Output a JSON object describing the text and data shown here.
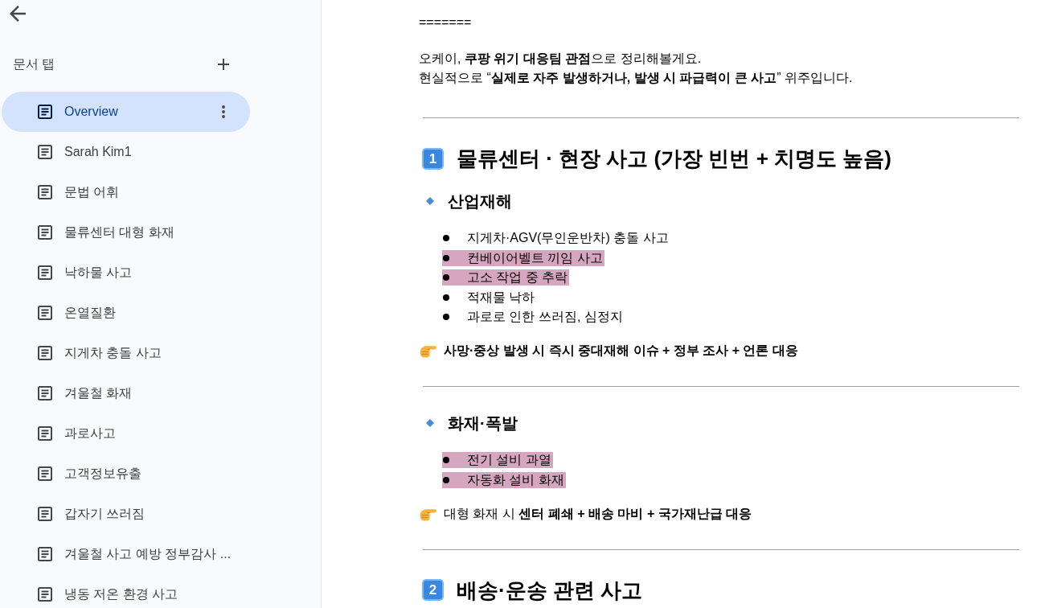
{
  "sidebar": {
    "title": "문서 탭",
    "tabs": [
      {
        "label": "Overview",
        "selected": true
      },
      {
        "label": "Sarah Kim1",
        "selected": false
      },
      {
        "label": "문법 어휘",
        "selected": false
      },
      {
        "label": "물류센터 대형 화재",
        "selected": false
      },
      {
        "label": "낙하물 사고",
        "selected": false
      },
      {
        "label": "온열질환",
        "selected": false
      },
      {
        "label": "지게차 충돌 사고",
        "selected": false
      },
      {
        "label": "겨울철 화재",
        "selected": false
      },
      {
        "label": "과로사고",
        "selected": false
      },
      {
        "label": "고객정보유출",
        "selected": false
      },
      {
        "label": "갑자기 쓰러짐",
        "selected": false
      },
      {
        "label": "겨울철 사고 예방 정부감사 ...",
        "selected": false
      },
      {
        "label": "냉동 저온 환경 사고",
        "selected": false
      }
    ]
  },
  "document": {
    "blocks": [
      {
        "kind": "text",
        "text": "======="
      },
      {
        "kind": "paragraph",
        "lines": [
          "오케이, **쿠팡 위기 대응팀 관점**으로 정리해볼게요.",
          "현실적으로 “**실제로 자주 발생하거나, 발생 시 파급력이 큰 사고**” 위주입니다."
        ]
      },
      {
        "kind": "rule"
      },
      {
        "kind": "heading",
        "number": "1",
        "text": "물류센터 · 현장 사고 (가장 빈번 + 치명도 높음)"
      },
      {
        "kind": "subheading",
        "text": "산업재해"
      },
      {
        "kind": "list",
        "items": [
          {
            "text": "지게차·AGV(무인운반차) 충돌 사고",
            "highlighted": false
          },
          {
            "text": "컨베이어벨트 끼임 사고",
            "highlighted": true
          },
          {
            "text": "고소 작업 중 추락",
            "highlighted": true
          },
          {
            "text": "적재물 낙하",
            "highlighted": false
          },
          {
            "text": "과로로 인한 쓰러짐, 심정지",
            "highlighted": false
          }
        ]
      },
      {
        "kind": "note",
        "bold": true,
        "text": "사망·중상 발생 시 즉시 중대재해 이슈 + 정부 조사 + 언론 대응"
      },
      {
        "kind": "rule"
      },
      {
        "kind": "subheading",
        "text": "화재·폭발"
      },
      {
        "kind": "list",
        "items": [
          {
            "text": "전기 설비 과열",
            "highlighted": true
          },
          {
            "text": "자동화 설비 화재",
            "highlighted": true
          }
        ]
      },
      {
        "kind": "note",
        "bold": false,
        "text": "대형 화재 시 **센터 폐쇄 + 배송 마비 + 국가재난급 대응**"
      },
      {
        "kind": "rule"
      },
      {
        "kind": "heading",
        "number": "2",
        "text": "배송·운송 관련 사고"
      }
    ]
  }
}
